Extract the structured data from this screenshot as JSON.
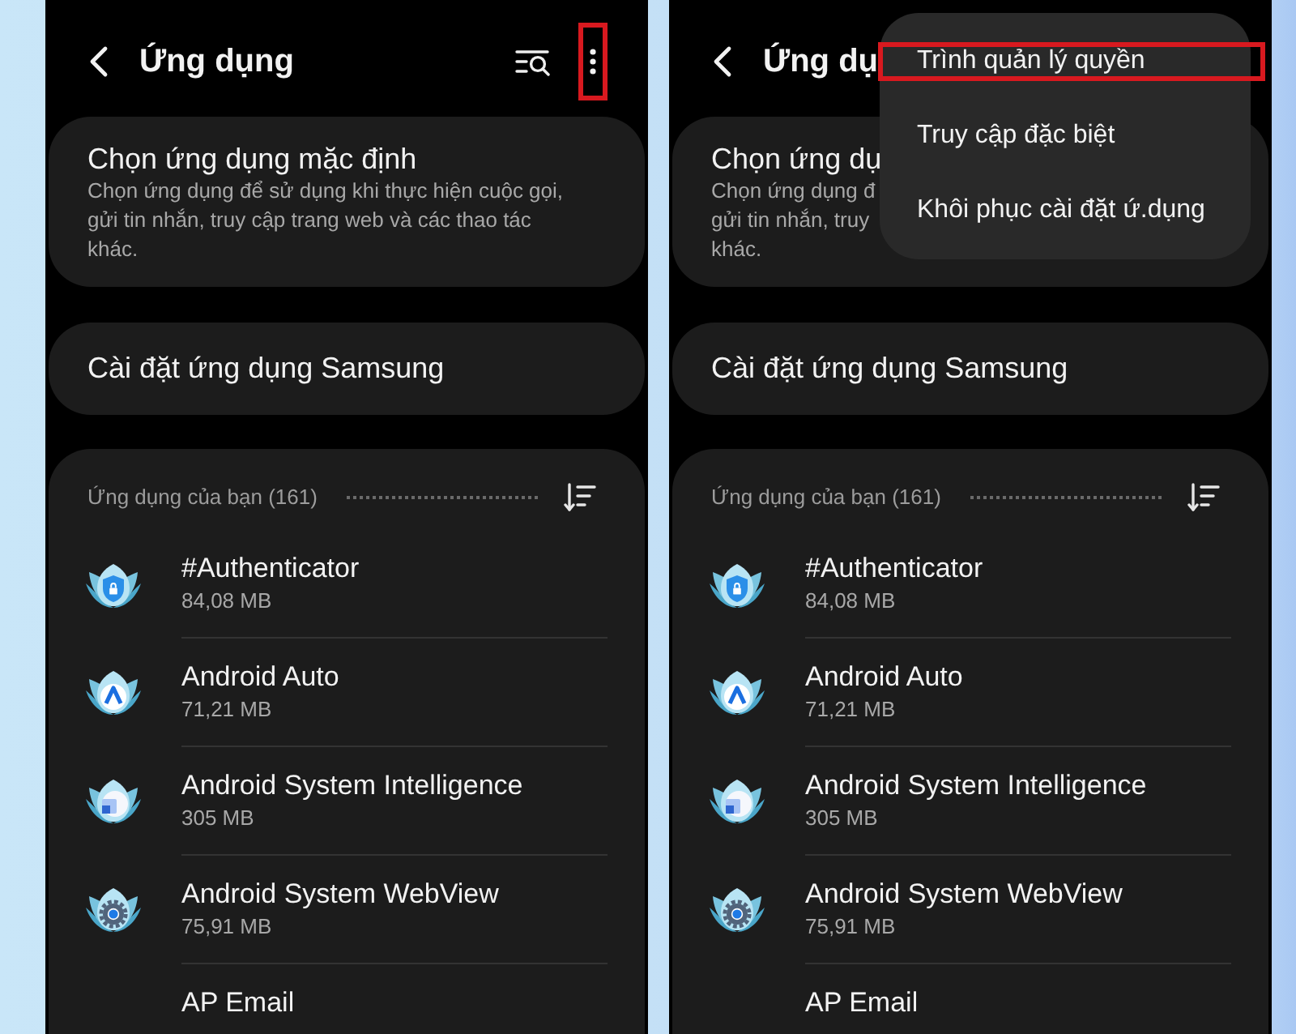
{
  "phones": [
    {
      "header": {
        "title": "Ứng dụng",
        "more_button": {
          "highlighted": true
        }
      },
      "cards": [
        {
          "title": "Chọn ứng dụng mặc định",
          "description": "Chọn ứng dụng để sử dụng khi thực hiện cuộc gọi,\ngửi tin nhắn, truy cập trang web và các thao tác\nkhác."
        },
        {
          "title": "Cài đặt ứng dụng Samsung"
        }
      ],
      "apps_section": {
        "title": "Ứng dụng của bạn (161)",
        "apps": [
          {
            "name": "#Authenticator",
            "size": "84,08 MB"
          },
          {
            "name": "Android Auto",
            "size": "71,21 MB"
          },
          {
            "name": "Android System Intelligence",
            "size": "305 MB"
          },
          {
            "name": "Android System WebView",
            "size": "75,91 MB"
          },
          {
            "name": "AP Email"
          }
        ]
      }
    },
    {
      "header": {
        "title": "Ứng dụ"
      },
      "cards": [
        {
          "title": "Chọn ứng dụ",
          "description": "Chọn ứng dụng đ\ngửi tin nhắn, truy\nkhác."
        },
        {
          "title": "Cài đặt ứng dụng Samsung"
        }
      ],
      "apps_section": {
        "title": "Ứng dụng của bạn (161)",
        "apps": [
          {
            "name": "#Authenticator",
            "size": "84,08 MB"
          },
          {
            "name": "Android Auto",
            "size": "71,21 MB"
          },
          {
            "name": "Android System Intelligence",
            "size": "305 MB"
          },
          {
            "name": "Android System WebView",
            "size": "75,91 MB"
          },
          {
            "name": "AP Email"
          }
        ]
      },
      "menu": {
        "items": [
          {
            "label": "Trình quản lý quyền",
            "highlighted": true
          },
          {
            "label": "Truy cập đặc biệt",
            "highlighted": false
          },
          {
            "label": "Khôi phục cài đặt ứ.dụng",
            "highlighted": false
          }
        ]
      }
    }
  ]
}
